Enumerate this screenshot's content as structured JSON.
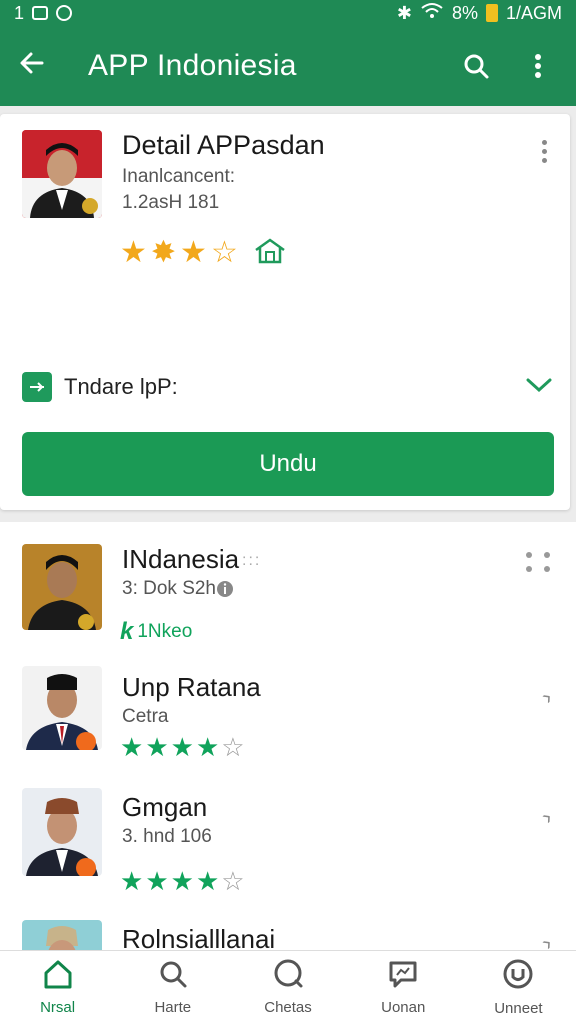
{
  "status_bar": {
    "left": "1",
    "battery": "8%",
    "time": "1/AGM"
  },
  "app_bar": {
    "title": "APP Indoniesia"
  },
  "detail": {
    "title": "Detail APPasdan",
    "subtitle": "Inanlcancent:",
    "meta": "1.2asH 181",
    "rating": 3,
    "badge_icon": "home-icon",
    "update_label": "Tndare lpP:",
    "download_label": "Undu"
  },
  "list": [
    {
      "title": "INdanesia",
      "sub": "3: Dok S2h",
      "installed": "1Nkeo"
    },
    {
      "title": "Unp Ratana",
      "sub": "Cetra",
      "stars": 4
    },
    {
      "title": "Gmgan",
      "sub": "3. hnd 106",
      "stars": 4
    },
    {
      "title": "Rolnsialllanai"
    }
  ],
  "nav": [
    {
      "label": "Nrsal",
      "icon": "home-icon"
    },
    {
      "label": "Harte",
      "icon": "search-icon"
    },
    {
      "label": "Chetas",
      "icon": "search-circle-icon"
    },
    {
      "label": "Uonan",
      "icon": "chat-icon"
    },
    {
      "label": "Unneet",
      "icon": "account-icon"
    }
  ],
  "colors": {
    "primary": "#1f8a55",
    "accent": "#10a35b",
    "star_gold": "#f2a81c"
  }
}
